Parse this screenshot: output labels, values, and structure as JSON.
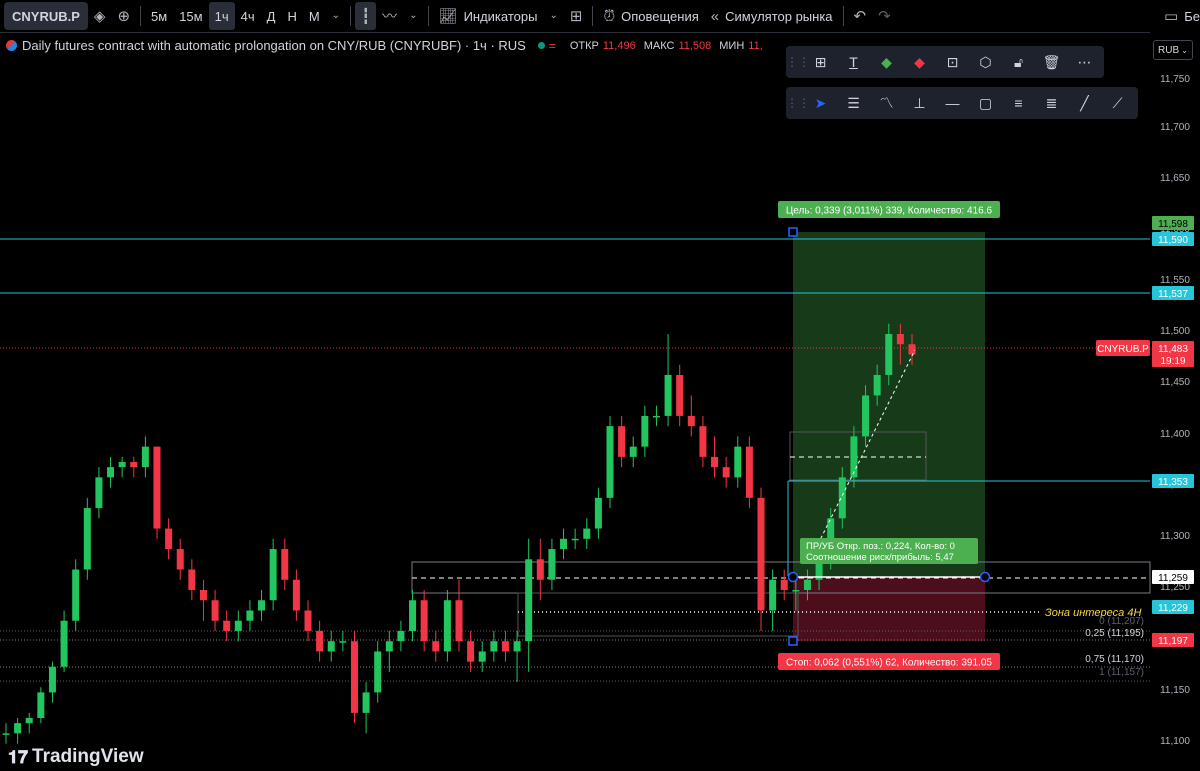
{
  "toolbar": {
    "symbol": "CNYRUB.P",
    "timeframes": [
      "5м",
      "15м",
      "1ч",
      "4ч",
      "Д",
      "Н",
      "М"
    ],
    "active_timeframe": "1ч",
    "indicators_label": "Индикаторы",
    "alerts_label": "Оповещения",
    "replay_label": "Симулятор рынка",
    "right_label": "Бе"
  },
  "legend": {
    "title": "Daily futures contract with automatic prolongation on CNY/RUB (CNYRUBF) · 1ч · RUS",
    "open_label": "ОТКР",
    "open": "11,496",
    "high_label": "МАКС",
    "high": "11,508",
    "low_label": "МИН",
    "low": "11,"
  },
  "currency_button": "RUB",
  "price_axis": {
    "ticks": [
      "11,750",
      "11,700",
      "11,650",
      "11,600",
      "11,550",
      "11,500",
      "11,450",
      "11,400",
      "11,350",
      "11,300",
      "11,250",
      "11,150",
      "11,100"
    ],
    "highlight_labels": [
      {
        "text": "11,598",
        "color": "#4caf50"
      },
      {
        "text": "11,590",
        "color": "#26c6da"
      },
      {
        "text": "11,537",
        "color": "#26c6da"
      },
      {
        "text": "11,483",
        "color": "#f23645"
      },
      {
        "text": "19:19",
        "color": "#f23645"
      },
      {
        "text": "11,353",
        "color": "#26c6da"
      },
      {
        "text": "11,259",
        "color": "#ffffff"
      },
      {
        "text": "11,229",
        "color": "#26c6da"
      },
      {
        "text": "11,197",
        "color": "#f23645"
      }
    ],
    "symbol_tag": "CNYRUB.P"
  },
  "position": {
    "target_label": "Цель: 0,339 (3,011%) 339, Количество: 416.6",
    "stop_label": "Стоп: 0,062 (0,551%) 62, Количество: 391.05",
    "info_line1": "ПР/УБ Откр. поз.: 0,224, Кол-во: 0",
    "info_line2": "Соотношение риск/прибыль: 5,47"
  },
  "annotations": {
    "zone": "Зона интереса 4H",
    "fib0": "0 (11,207)",
    "fib025": "0,25 (11,195)",
    "fib075": "0,75 (11,170)",
    "fib1": "1 (11,157)"
  },
  "watermark": "TradingView",
  "colors": {
    "up": "#22c55e",
    "down": "#f23645",
    "bg": "#000000",
    "cyan": "#26c6da"
  },
  "chart_data": {
    "type": "candlestick",
    "note_scale": "price axis 11,100 – 11,750",
    "ylim": [
      11.09,
      11.77
    ],
    "candles": [
      [
        11.11,
        11.12,
        11.1,
        11.11
      ],
      [
        11.11,
        11.125,
        11.1,
        11.12
      ],
      [
        11.12,
        11.13,
        11.11,
        11.125
      ],
      [
        11.125,
        11.155,
        11.12,
        11.15
      ],
      [
        11.15,
        11.18,
        11.14,
        11.175
      ],
      [
        11.175,
        11.23,
        11.17,
        11.22
      ],
      [
        11.22,
        11.28,
        11.21,
        11.27
      ],
      [
        11.27,
        11.34,
        11.26,
        11.33
      ],
      [
        11.33,
        11.37,
        11.32,
        11.36
      ],
      [
        11.36,
        11.38,
        11.35,
        11.37
      ],
      [
        11.37,
        11.38,
        11.36,
        11.375
      ],
      [
        11.375,
        11.38,
        11.36,
        11.37
      ],
      [
        11.37,
        11.4,
        11.36,
        11.39
      ],
      [
        11.39,
        11.39,
        11.3,
        11.31
      ],
      [
        11.31,
        11.32,
        11.28,
        11.29
      ],
      [
        11.29,
        11.3,
        11.26,
        11.27
      ],
      [
        11.27,
        11.28,
        11.24,
        11.25
      ],
      [
        11.25,
        11.26,
        11.22,
        11.24
      ],
      [
        11.24,
        11.25,
        11.21,
        11.22
      ],
      [
        11.22,
        11.23,
        11.2,
        11.21
      ],
      [
        11.21,
        11.23,
        11.2,
        11.22
      ],
      [
        11.22,
        11.24,
        11.21,
        11.23
      ],
      [
        11.23,
        11.25,
        11.22,
        11.24
      ],
      [
        11.24,
        11.3,
        11.23,
        11.29
      ],
      [
        11.29,
        11.3,
        11.25,
        11.26
      ],
      [
        11.26,
        11.27,
        11.22,
        11.23
      ],
      [
        11.23,
        11.24,
        11.2,
        11.21
      ],
      [
        11.21,
        11.22,
        11.18,
        11.19
      ],
      [
        11.19,
        11.21,
        11.18,
        11.2
      ],
      [
        11.2,
        11.21,
        11.19,
        11.2
      ],
      [
        11.2,
        11.21,
        11.12,
        11.13
      ],
      [
        11.13,
        11.16,
        11.11,
        11.15
      ],
      [
        11.15,
        11.2,
        11.14,
        11.19
      ],
      [
        11.19,
        11.21,
        11.17,
        11.2
      ],
      [
        11.2,
        11.22,
        11.19,
        11.21
      ],
      [
        11.21,
        11.25,
        11.2,
        11.24
      ],
      [
        11.24,
        11.25,
        11.19,
        11.2
      ],
      [
        11.2,
        11.21,
        11.18,
        11.19
      ],
      [
        11.19,
        11.25,
        11.18,
        11.24
      ],
      [
        11.24,
        11.26,
        11.19,
        11.2
      ],
      [
        11.2,
        11.21,
        11.17,
        11.18
      ],
      [
        11.18,
        11.2,
        11.17,
        11.19
      ],
      [
        11.19,
        11.21,
        11.18,
        11.2
      ],
      [
        11.2,
        11.21,
        11.18,
        11.19
      ],
      [
        11.19,
        11.21,
        11.16,
        11.2
      ],
      [
        11.2,
        11.3,
        11.17,
        11.28
      ],
      [
        11.28,
        11.3,
        11.24,
        11.26
      ],
      [
        11.26,
        11.3,
        11.25,
        11.29
      ],
      [
        11.29,
        11.31,
        11.28,
        11.3
      ],
      [
        11.3,
        11.31,
        11.29,
        11.3
      ],
      [
        11.3,
        11.32,
        11.29,
        11.31
      ],
      [
        11.31,
        11.35,
        11.3,
        11.34
      ],
      [
        11.34,
        11.42,
        11.33,
        11.41
      ],
      [
        11.41,
        11.42,
        11.37,
        11.38
      ],
      [
        11.38,
        11.4,
        11.37,
        11.39
      ],
      [
        11.39,
        11.43,
        11.38,
        11.42
      ],
      [
        11.42,
        11.43,
        11.41,
        11.42
      ],
      [
        11.42,
        11.5,
        11.41,
        11.46
      ],
      [
        11.46,
        11.47,
        11.41,
        11.42
      ],
      [
        11.42,
        11.44,
        11.4,
        11.41
      ],
      [
        11.41,
        11.42,
        11.37,
        11.38
      ],
      [
        11.38,
        11.4,
        11.36,
        11.37
      ],
      [
        11.37,
        11.38,
        11.35,
        11.36
      ],
      [
        11.36,
        11.4,
        11.35,
        11.39
      ],
      [
        11.39,
        11.4,
        11.33,
        11.34
      ],
      [
        11.34,
        11.35,
        11.21,
        11.23
      ],
      [
        11.23,
        11.27,
        11.21,
        11.26
      ],
      [
        11.26,
        11.27,
        11.24,
        11.25
      ],
      [
        11.25,
        11.26,
        11.23,
        11.25
      ],
      [
        11.25,
        11.27,
        11.24,
        11.26
      ],
      [
        11.26,
        11.29,
        11.25,
        11.28
      ],
      [
        11.28,
        11.33,
        11.27,
        11.32
      ],
      [
        11.32,
        11.37,
        11.31,
        11.36
      ],
      [
        11.36,
        11.41,
        11.35,
        11.4
      ],
      [
        11.4,
        11.45,
        11.39,
        11.44
      ],
      [
        11.44,
        11.47,
        11.43,
        11.46
      ],
      [
        11.46,
        11.51,
        11.45,
        11.5
      ],
      [
        11.5,
        11.51,
        11.47,
        11.49
      ],
      [
        11.49,
        11.5,
        11.47,
        11.48
      ]
    ]
  }
}
